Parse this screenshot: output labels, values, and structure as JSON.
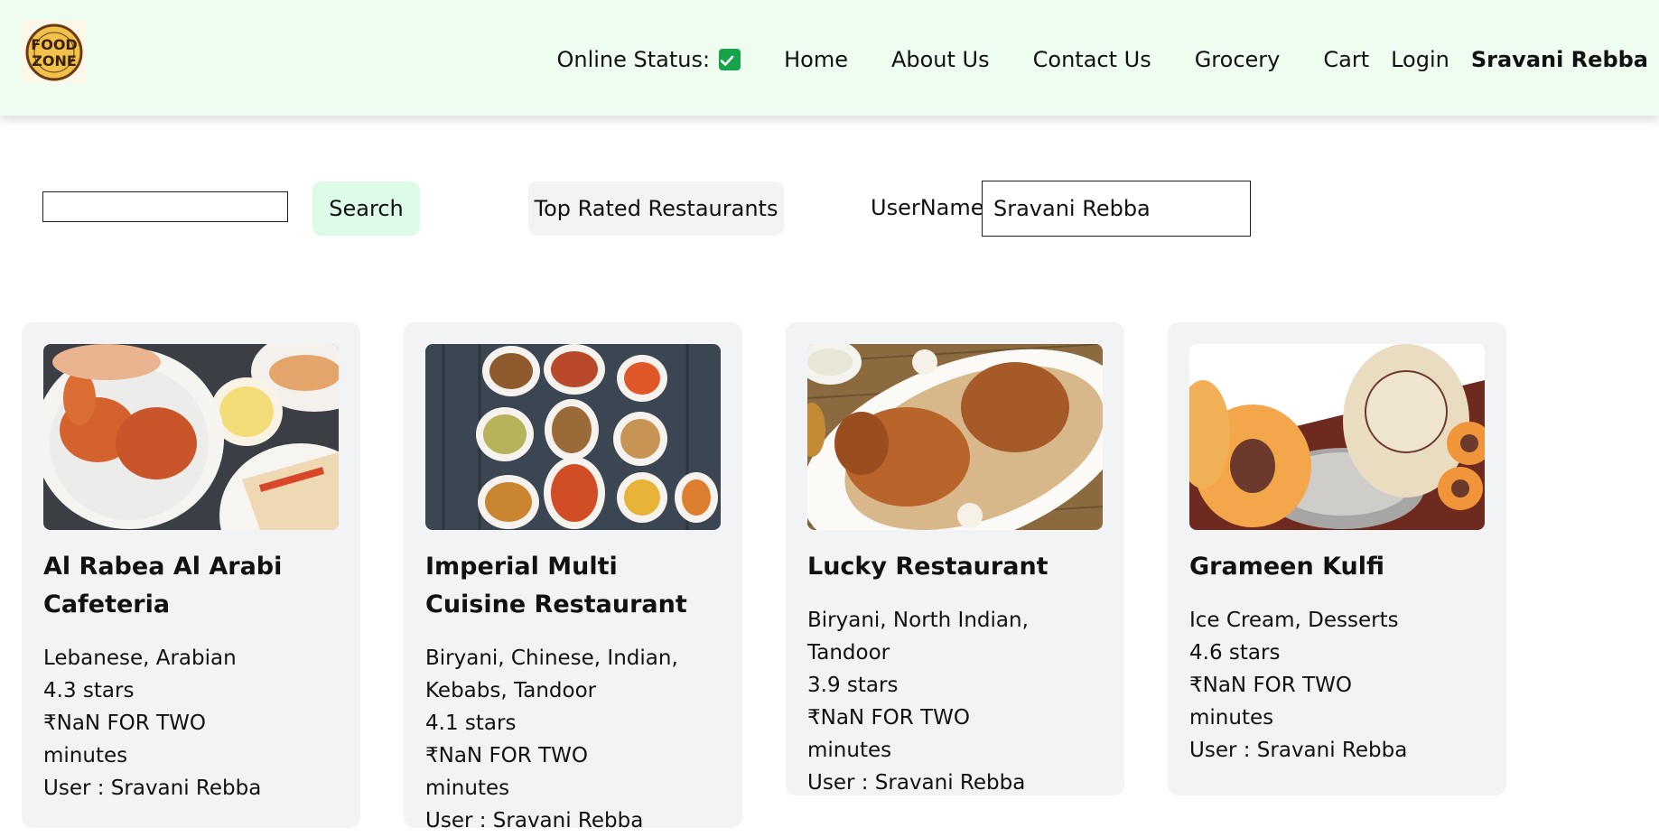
{
  "header": {
    "logo_text": "FOOD ZONE",
    "online_status_label": "Online Status:",
    "nav": [
      "Home",
      "About Us",
      "Contact Us",
      "Grocery"
    ],
    "cart_label": "Cart",
    "login_label": "Login",
    "user_name": "Sravani Rebba"
  },
  "toolbar": {
    "search_value": "",
    "search_button": "Search",
    "top_rated_button": "Top Rated Restaurants",
    "username_label": "UserName :",
    "username_value": "Sravani Rebba"
  },
  "restaurants": [
    {
      "name": "Al Rabea Al Arabi Cafeteria",
      "cuisines": "Lebanese, Arabian",
      "rating": "4.3 stars",
      "cost": "₹NaN FOR TWO",
      "time": "minutes",
      "user": "User : Sravani Rebba"
    },
    {
      "name": "Imperial Multi Cuisine Restaurant",
      "cuisines": "Biryani, Chinese, Indian, Kebabs, Tandoor",
      "rating": "4.1 stars",
      "cost": "₹NaN FOR TWO",
      "time": "minutes",
      "user": "User : Sravani Rebba"
    },
    {
      "name": "Lucky Restaurant",
      "cuisines": "Biryani, North Indian, Tandoor",
      "rating": "3.9 stars",
      "cost": "₹NaN FOR TWO",
      "time": "minutes",
      "user": "User : Sravani Rebba"
    },
    {
      "name": "Grameen Kulfi",
      "cuisines": "Ice Cream, Desserts",
      "rating": "4.6 stars",
      "cost": "₹NaN FOR TWO",
      "time": "minutes",
      "user": "User : Sravani Rebba"
    }
  ],
  "colors": {
    "header_bg": "#effcf0",
    "card_bg": "#f2f3f5",
    "search_button_bg": "#dcfce7",
    "status_check": "#16a34a"
  }
}
